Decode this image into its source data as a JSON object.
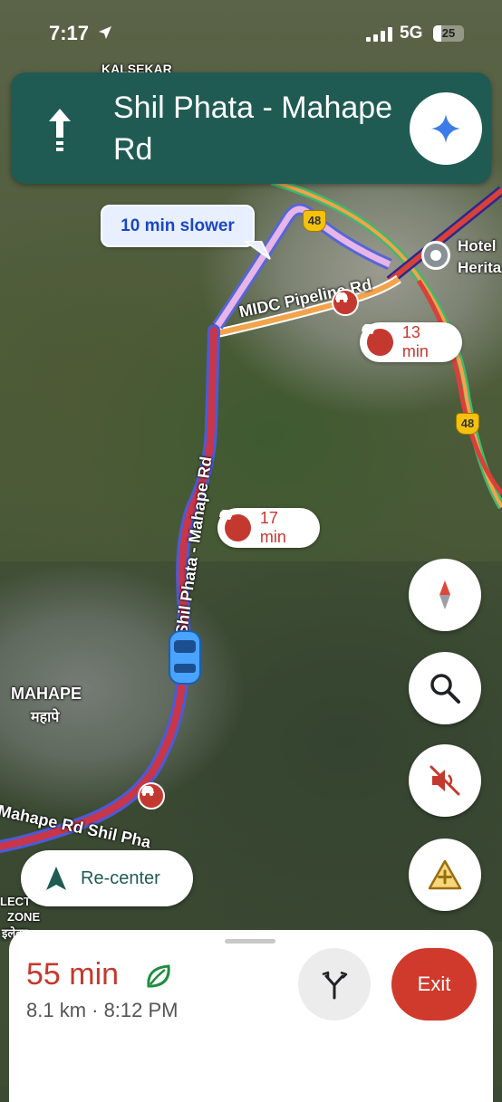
{
  "status_bar": {
    "time": "7:17",
    "network": "5G",
    "battery": "25"
  },
  "navigation": {
    "street": "Shil Phata - Mahape Rd"
  },
  "map": {
    "traffic_callout": "10 min slower",
    "incidents": [
      {
        "time": "13 min"
      },
      {
        "time": "17 min"
      }
    ],
    "highway_shield": "48",
    "road_labels": {
      "midc": "MIDC Pipeline Rd",
      "route_vertical": "Shil Phata - Mahape Rd",
      "route_lower": "Mahape Rd Shil Pha"
    },
    "places": {
      "mahape": "MAHAPE",
      "mahape_local": "महापे",
      "hotel_1": "Hotel",
      "hotel_2": "Herita",
      "north_label": "KALSEKAR",
      "zone_1": "LECT",
      "zone_2": "ZONE",
      "zone_3": "इलेक्ट"
    }
  },
  "controls": {
    "recenter_label": "Re-center"
  },
  "trip": {
    "duration": "55 min",
    "distance_eta": "8.1 km · 8:12 PM",
    "exit_label": "Exit"
  },
  "colors": {
    "banner": "#1f5b53",
    "traffic_red": "#c4392f",
    "route_blue": "#4b5bd6",
    "exit": "#cf3a2c"
  }
}
